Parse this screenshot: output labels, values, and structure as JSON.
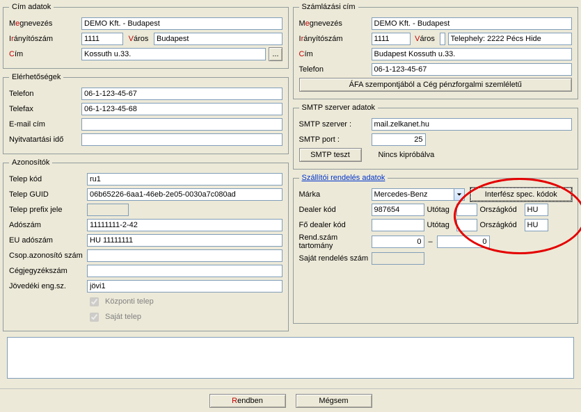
{
  "cim_adatok": {
    "legend": "Cím adatok",
    "megnevezes_label_pre": "M",
    "megnevezes_label_hot": "e",
    "megnevezes_label_post": "gnevezés",
    "megnevezes": "DEMO Kft. - Budapest",
    "iranyitoszam_label_pre": "I",
    "iranyitoszam_label_hot": "r",
    "iranyitoszam_label_post": "ányítószám",
    "iranyitoszam": "1111",
    "varos_label_pre": "",
    "varos_label_hot": "V",
    "varos_label_post": "áros",
    "varos": "Budapest",
    "cim_label_pre": "",
    "cim_label_hot": "C",
    "cim_label_post": "ím",
    "cim": "Kossuth u.33.",
    "ellipsis_btn": "..."
  },
  "elerhetosegek": {
    "legend": "Elérhetőségek",
    "telefon_label": "Telefon",
    "telefon": "06-1-123-45-67",
    "telefax_label": "Telefax",
    "telefax": "06-1-123-45-68",
    "email_label": "E-mail cím",
    "email": "",
    "nyitva_label": "Nyitvatartási idő",
    "nyitva": ""
  },
  "azonositok": {
    "legend": "Azonosítók",
    "telepkod_label": "Telep kód",
    "telepkod": "ru1",
    "telepguid_label": "Telep GUID",
    "telepguid": "06b65226-6aa1-46eb-2e05-0030a7c080ad",
    "prefix_label": "Telep prefix jele",
    "prefix": "",
    "adoszam_label": "Adószám",
    "adoszam": "11111111-2-42",
    "eu_label": "EU adószám",
    "eu": "HU 11111111",
    "csop_label": "Csop.azonosító szám",
    "csop": "",
    "cegjegyzek_label": "Cégjegyzékszám",
    "cegjegyzek": "",
    "jovedeki_label": "Jövedéki eng.sz.",
    "jovedeki": "jövi1",
    "kozponti_label": "Központi telep",
    "sajat_label": "Saját telep"
  },
  "szamlazasi": {
    "legend": "Számlázási cím",
    "megnevezes": "DEMO Kft. - Budapest",
    "iranyitoszam": "1111",
    "varos": "",
    "telephely": "Telephely: 2222 Pécs Hide",
    "cim": "Budapest Kossuth u.33.",
    "telefon_label": "Telefon",
    "telefon": "06-1-123-45-67",
    "afa_btn": "ÁFA szempontjából a Cég pénzforgalmi szemléletű"
  },
  "smtp": {
    "legend": "SMTP szerver adatok",
    "server_label": "SMTP szerver :",
    "server": "mail.zelkanet.hu",
    "port_label": "SMTP port :",
    "port": "25",
    "test_btn": "SMTP teszt",
    "status": "Nincs kipróbálva"
  },
  "szallitoi": {
    "legend": "Szállítói rendelés adatok",
    "marka_label": "Márka",
    "marka": "Mercedes-Benz",
    "interfesz_btn": "Interfész spec. kódok",
    "dealer_label": "Dealer kód",
    "dealer": "987654",
    "utotag_label": "Utótag",
    "utotag1": "",
    "utotag2": "",
    "orszagkod_label": "Országkód",
    "orszag1": "HU",
    "orszag2": "HU",
    "fodealer_label": "Fő dealer kód",
    "fodealer": "",
    "rendszam_label": "Rend.szám tartomány",
    "rend_from": "0",
    "dash": "–",
    "rend_to": "0",
    "sajatrend_label": "Saját rendelés szám",
    "sajatrend": ""
  },
  "footer": {
    "ok_pre": "",
    "ok_hot": "R",
    "ok_post": "endben",
    "cancel": "Mégsem"
  }
}
